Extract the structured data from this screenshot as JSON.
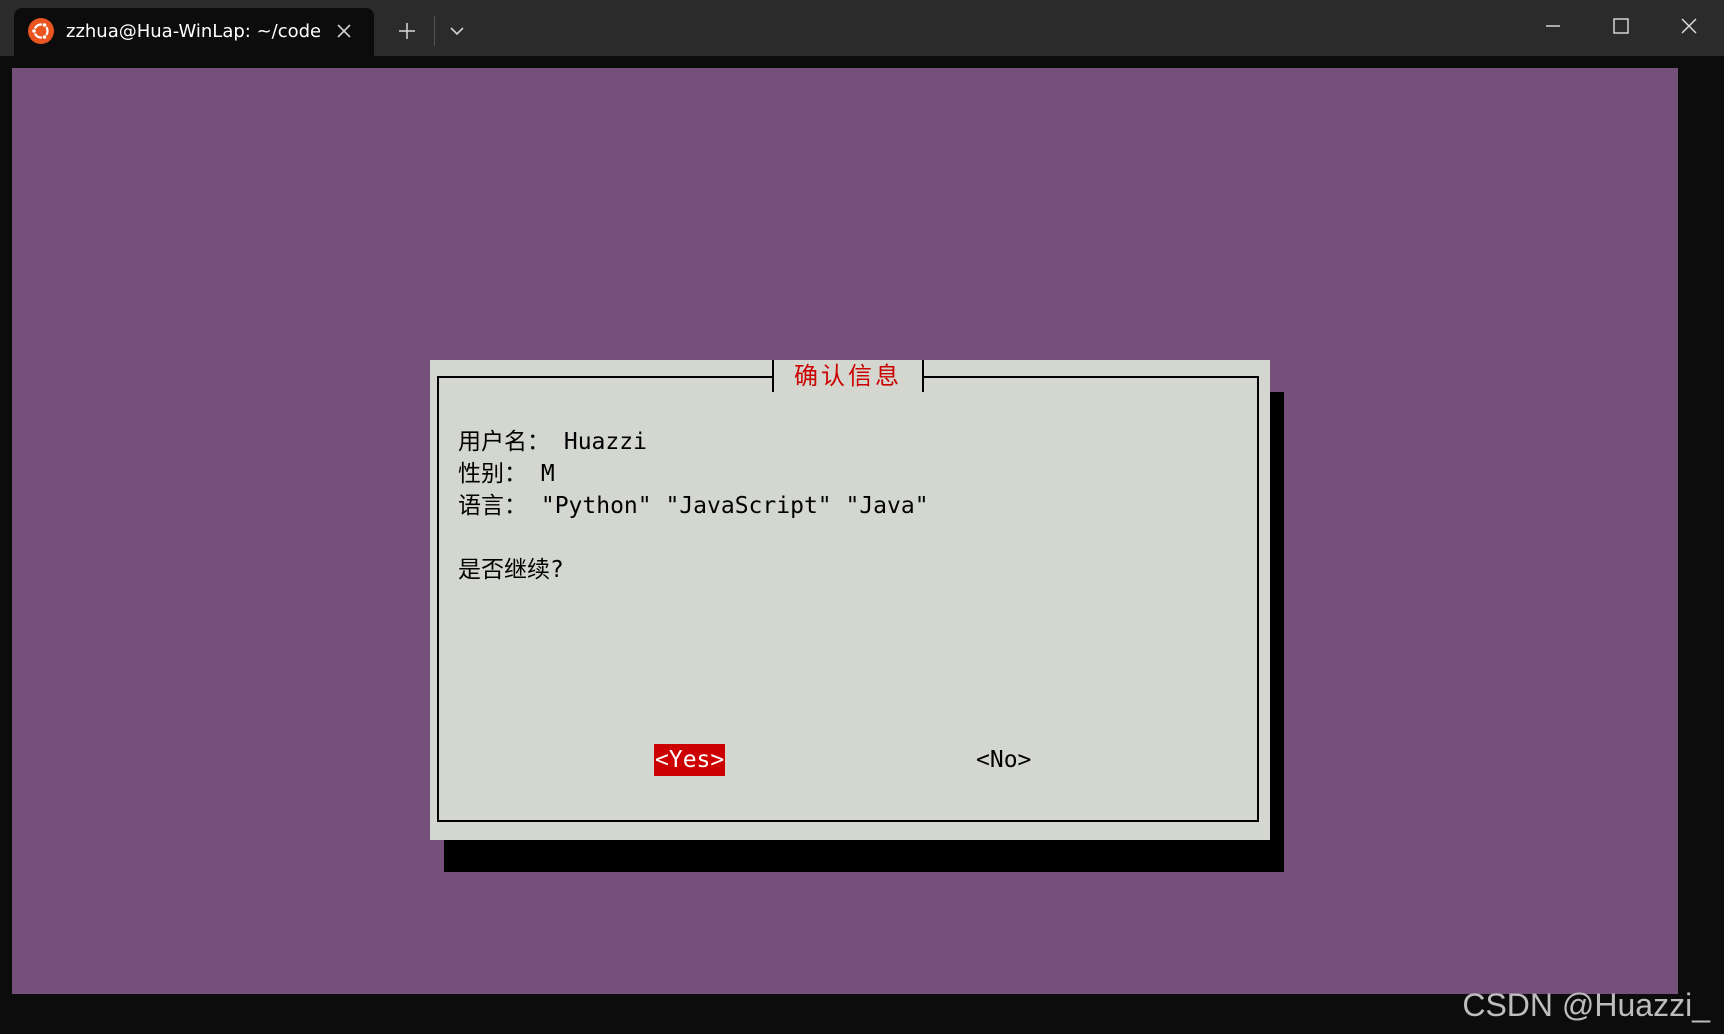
{
  "window": {
    "tab_title": "zzhua@Hua-WinLap: ~/code",
    "tab_icon": "ubuntu-icon",
    "accent": "#e95420"
  },
  "terminal": {
    "background": "#75507b"
  },
  "dialog": {
    "title": "确认信息",
    "lines": [
      "用户名： Huazzi",
      "性别： M",
      "语言： \"Python\" \"JavaScript\" \"Java\"",
      "",
      "是否继续?"
    ],
    "yes_label": "<Yes>",
    "no_label": "<No>",
    "title_color": "#cc0000",
    "selected_color": "#cc0000"
  },
  "watermark": "CSDN @Huazzi_"
}
